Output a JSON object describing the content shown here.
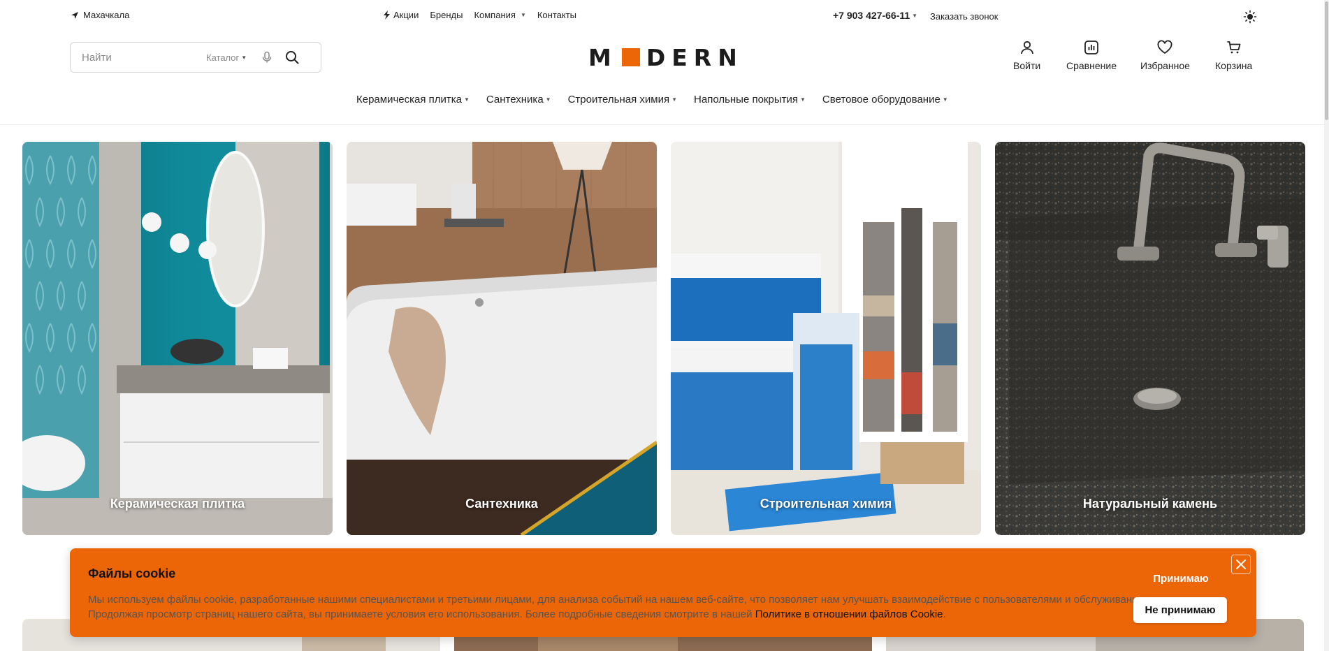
{
  "colors": {
    "accent": "#ec6608",
    "text": "#222222",
    "muted": "#888888",
    "border": "#d6d6d6"
  },
  "topbar": {
    "city": {
      "icon": "location-arrow-icon",
      "label": "Махачкала"
    },
    "nav": [
      {
        "label": "Акции",
        "icon": "lightning-icon"
      },
      {
        "label": "Бренды"
      },
      {
        "label": "Компания",
        "has_dropdown": true
      },
      {
        "label": "Контакты"
      }
    ],
    "phone": "+7 903 427-66-11",
    "callback": "Заказать звонок",
    "theme_icon": "sun-icon"
  },
  "search": {
    "placeholder": "Найти",
    "catalog_label": "Каталог",
    "mic_icon": "microphone-icon",
    "search_icon": "search-icon"
  },
  "logo": {
    "left": "M",
    "right": "DERN"
  },
  "user_nav": [
    {
      "label": "Войти",
      "icon": "user-icon"
    },
    {
      "label": "Сравнение",
      "icon": "compare-chart-icon"
    },
    {
      "label": "Избранное",
      "icon": "heart-icon"
    },
    {
      "label": "Корзина",
      "icon": "cart-icon"
    }
  ],
  "categories": [
    "Керамическая плитка",
    "Сантехника",
    "Строительная химия",
    "Напольные покрытия",
    "Световое оборудование"
  ],
  "tiles": [
    {
      "label": "Керамическая плитка"
    },
    {
      "label": "Сантехника"
    },
    {
      "label": "Строительная химия"
    },
    {
      "label": "Натуральный камень"
    }
  ],
  "cookie": {
    "title": "Файлы cookie",
    "text": "Мы используем файлы cookie, разработанные нашими специалистами и третьими лицами, для анализа событий на нашем веб-сайте, что позволяет нам улучшать взаимодействие с пользователями и обслуживание. Продолжая просмотр страниц нашего сайта, вы принимаете условия его использования. Более подробные сведения смотрите в нашей ",
    "link": "Политике в отношении файлов Cookie",
    "text_end": ".",
    "accept": "Принимаю",
    "decline": "Не принимаю",
    "close_icon": "close-icon"
  }
}
